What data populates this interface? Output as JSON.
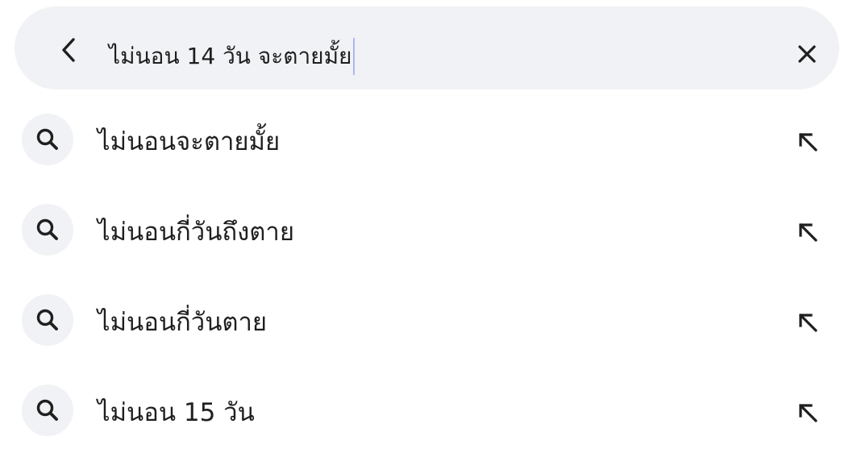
{
  "search": {
    "query": "ไม่นอน 14 วัน จะตายมั้ย"
  },
  "icons": {
    "back": "chevron-left-icon",
    "clear": "close-icon",
    "suggestion": "search-icon",
    "fill": "arrow-up-left-icon"
  },
  "colors": {
    "search_bar_bg": "#f1f2f5",
    "text": "#1f1f1f",
    "caret": "#a9b8f2"
  },
  "suggestions": [
    {
      "label": "ไม่นอนจะตายมั้ย"
    },
    {
      "label": "ไม่นอนกี่วันถึงตาย"
    },
    {
      "label": "ไม่นอนกี่วันตาย"
    },
    {
      "label": "ไม่นอน 15 วัน"
    }
  ]
}
